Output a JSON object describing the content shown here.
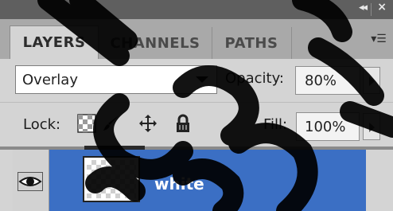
{
  "panel": {
    "tabs": [
      {
        "label": "LAYERS",
        "active": true
      },
      {
        "label": "CHANNELS",
        "active": false
      },
      {
        "label": "PATHS",
        "active": false
      }
    ],
    "menu_icon": "panel-menu-icon",
    "collapse_icon": "double-chevron-left-icon",
    "close_icon": "close-icon"
  },
  "blend": {
    "mode": "Overlay",
    "opacity_label": "Opacity:",
    "opacity_value": "80%"
  },
  "lock": {
    "label": "Lock:",
    "icons": [
      "lock-transparent-pixels-icon",
      "lock-image-pixels-icon",
      "lock-position-icon",
      "lock-all-icon"
    ],
    "fill_label": "Fill:",
    "fill_value": "100%"
  },
  "layers": [
    {
      "name": "white",
      "visible": true,
      "selected": true
    }
  ],
  "colors": {
    "selected_layer": "#3b6fc4",
    "panel_bg": "#d4d4d4",
    "titlebar": "#5f5f5f"
  }
}
